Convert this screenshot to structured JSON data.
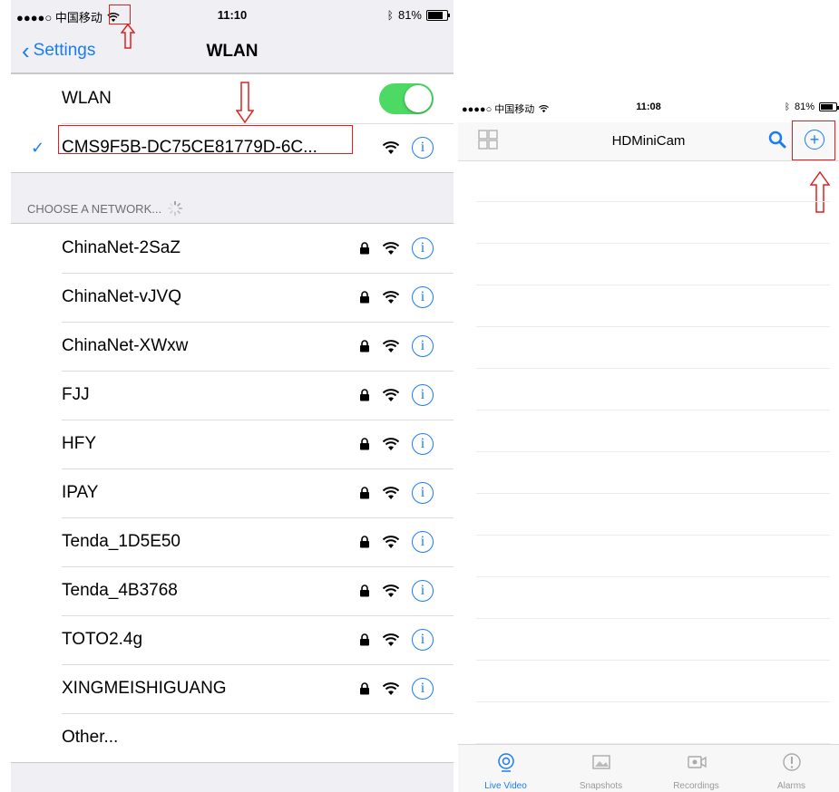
{
  "left": {
    "status": {
      "carrier": "●●●●○ 中国移动",
      "time": "11:10",
      "battery": "81%"
    },
    "nav": {
      "back_label": "Settings",
      "title": "WLAN"
    },
    "wlan_label": "WLAN",
    "connected_network": "CMS9F5B-DC75CE81779D-6C...",
    "section_header": "CHOOSE A NETWORK...",
    "networks": [
      {
        "name": "ChinaNet-2SaZ"
      },
      {
        "name": "ChinaNet-vJVQ"
      },
      {
        "name": "ChinaNet-XWxw"
      },
      {
        "name": "FJJ"
      },
      {
        "name": "HFY"
      },
      {
        "name": "IPAY"
      },
      {
        "name": "Tenda_1D5E50"
      },
      {
        "name": "Tenda_4B3768"
      },
      {
        "name": "TOTO2.4g"
      },
      {
        "name": "XINGMEISHIGUANG"
      }
    ],
    "other_label": "Other...",
    "info_glyph": "i",
    "check_glyph": "✓"
  },
  "right": {
    "status": {
      "carrier": "●●●●○ 中国移动",
      "time": "11:08",
      "battery": "81%"
    },
    "title": "HDMiniCam",
    "plus_glyph": "+",
    "tabs": [
      {
        "label": "Live Video",
        "icon": "camera-lens-icon"
      },
      {
        "label": "Snapshots",
        "icon": "image-icon"
      },
      {
        "label": "Recordings",
        "icon": "video-camera-icon"
      },
      {
        "label": "Alarms",
        "icon": "alert-icon"
      }
    ]
  },
  "colors": {
    "accent": "#1a7cf5",
    "toggle_on": "#4cd964",
    "annotation": "#e02020"
  }
}
